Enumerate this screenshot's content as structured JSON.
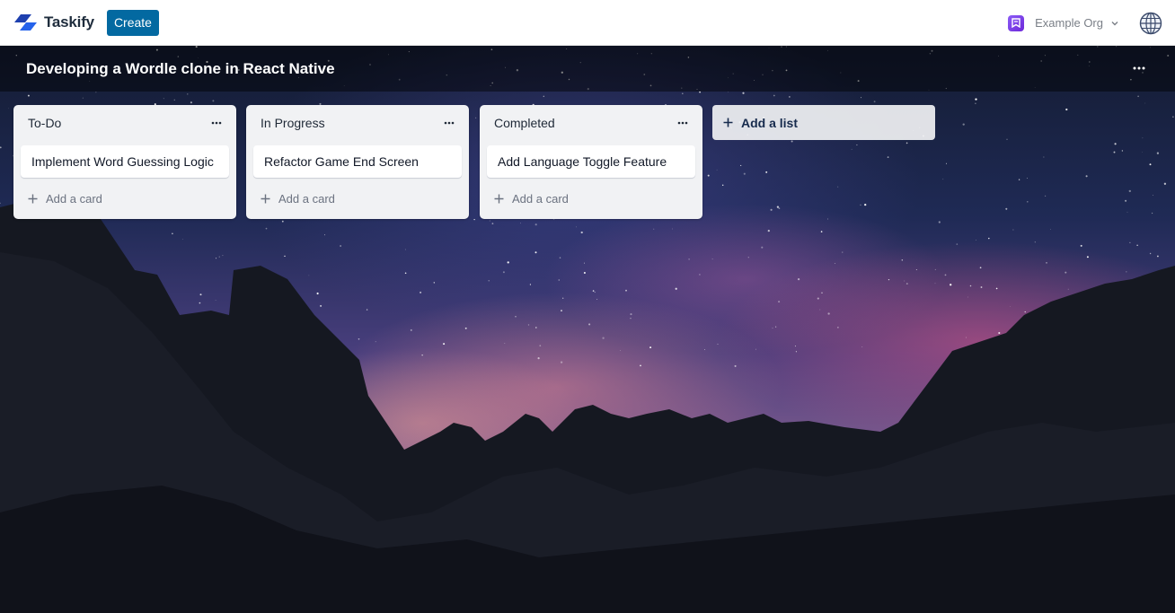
{
  "app": {
    "name": "Taskify",
    "create_label": "Create",
    "org_name": "Example Org"
  },
  "board": {
    "title": "Developing a Wordle clone in React Native",
    "add_list_label": "Add a list"
  },
  "lists": [
    {
      "title": "To-Do",
      "cards": [
        "Implement Word Guessing Logic"
      ],
      "add_card_label": "Add a card"
    },
    {
      "title": "In Progress",
      "cards": [
        "Refactor Game End Screen"
      ],
      "add_card_label": "Add a card"
    },
    {
      "title": "Completed",
      "cards": [
        "Add Language Toggle Feature"
      ],
      "add_card_label": "Add a card"
    }
  ],
  "colors": {
    "create_button": "#0369a1",
    "org_avatar": "#7c3aed",
    "list_background": "#f1f2f4"
  },
  "icons": {
    "logo": "taskify-logo-icon",
    "org": "org-avatar-icon",
    "chevron": "chevron-down-icon",
    "globe": "globe-user-icon",
    "board_menu": "more-horizontal-icon",
    "list_menu": "more-horizontal-icon",
    "add": "plus-icon"
  }
}
